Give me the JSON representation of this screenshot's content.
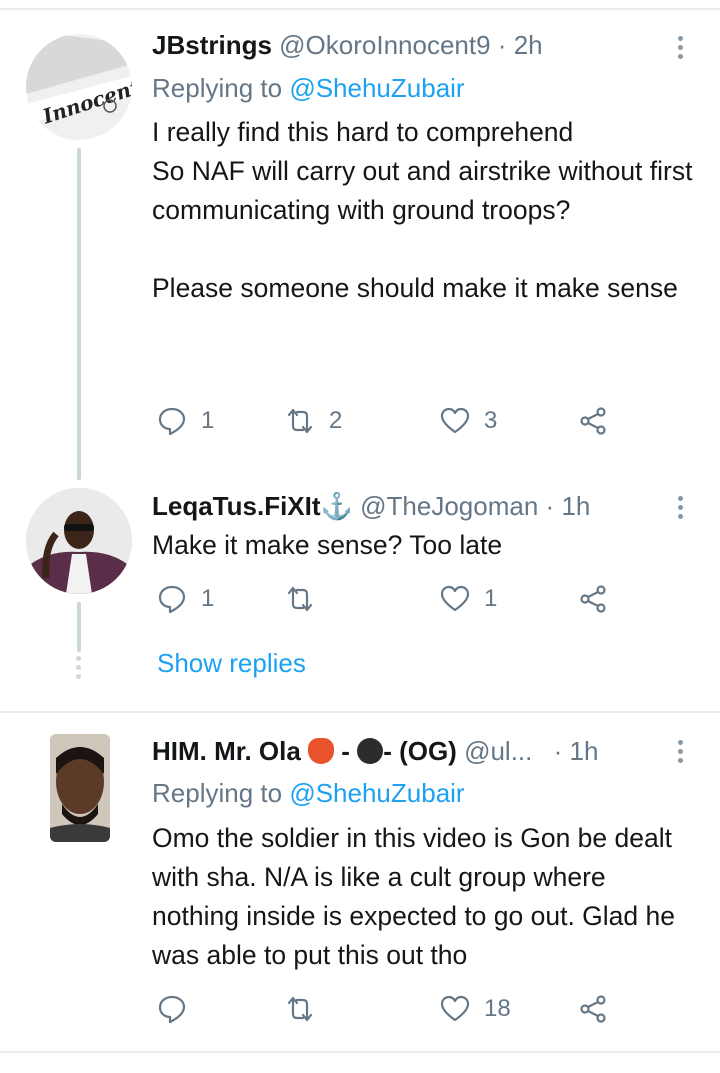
{
  "tweets": [
    {
      "name": "JBstrings",
      "handle": "@OkoroInnocent9",
      "dot": "·",
      "time": "2h",
      "replying_prefix": "Replying to",
      "replying_to": "@ShehuZubair",
      "text": "I really find this hard to comprehend\nSo NAF will carry out and airstrike without first communicating with ground troops?\n\nPlease someone should make it make sense",
      "replies": "1",
      "retweets": "2",
      "likes": "3",
      "avatar_text": "Innocent"
    },
    {
      "name": "LeqaTus.FiXIt",
      "name_symbol": "⚓",
      "handle": "@TheJogoman",
      "dot": "·",
      "time": "1h",
      "text": "Make it make sense? Too late",
      "replies": "1",
      "retweets": "",
      "likes": "1"
    },
    {
      "name": "HIM. Mr. Ola",
      "name_suffix_1": "-",
      "name_suffix_2": "- (OG)",
      "handle": "@ul...",
      "dot": "·",
      "time": "1h",
      "replying_prefix": "Replying to",
      "replying_to": "@ShehuZubair",
      "text": "Omo the soldier in this video is Gon be dealt with sha. N/A is like a cult group where nothing inside is expected to go out. Glad he was able to put this out tho",
      "replies": "",
      "retweets": "",
      "likes": "18"
    }
  ],
  "show_replies": "Show replies",
  "colors": {
    "link": "#1da1f2",
    "secondary": "#657786",
    "separator": "#e6ecf0",
    "thread_line": "#ccd6dd"
  }
}
